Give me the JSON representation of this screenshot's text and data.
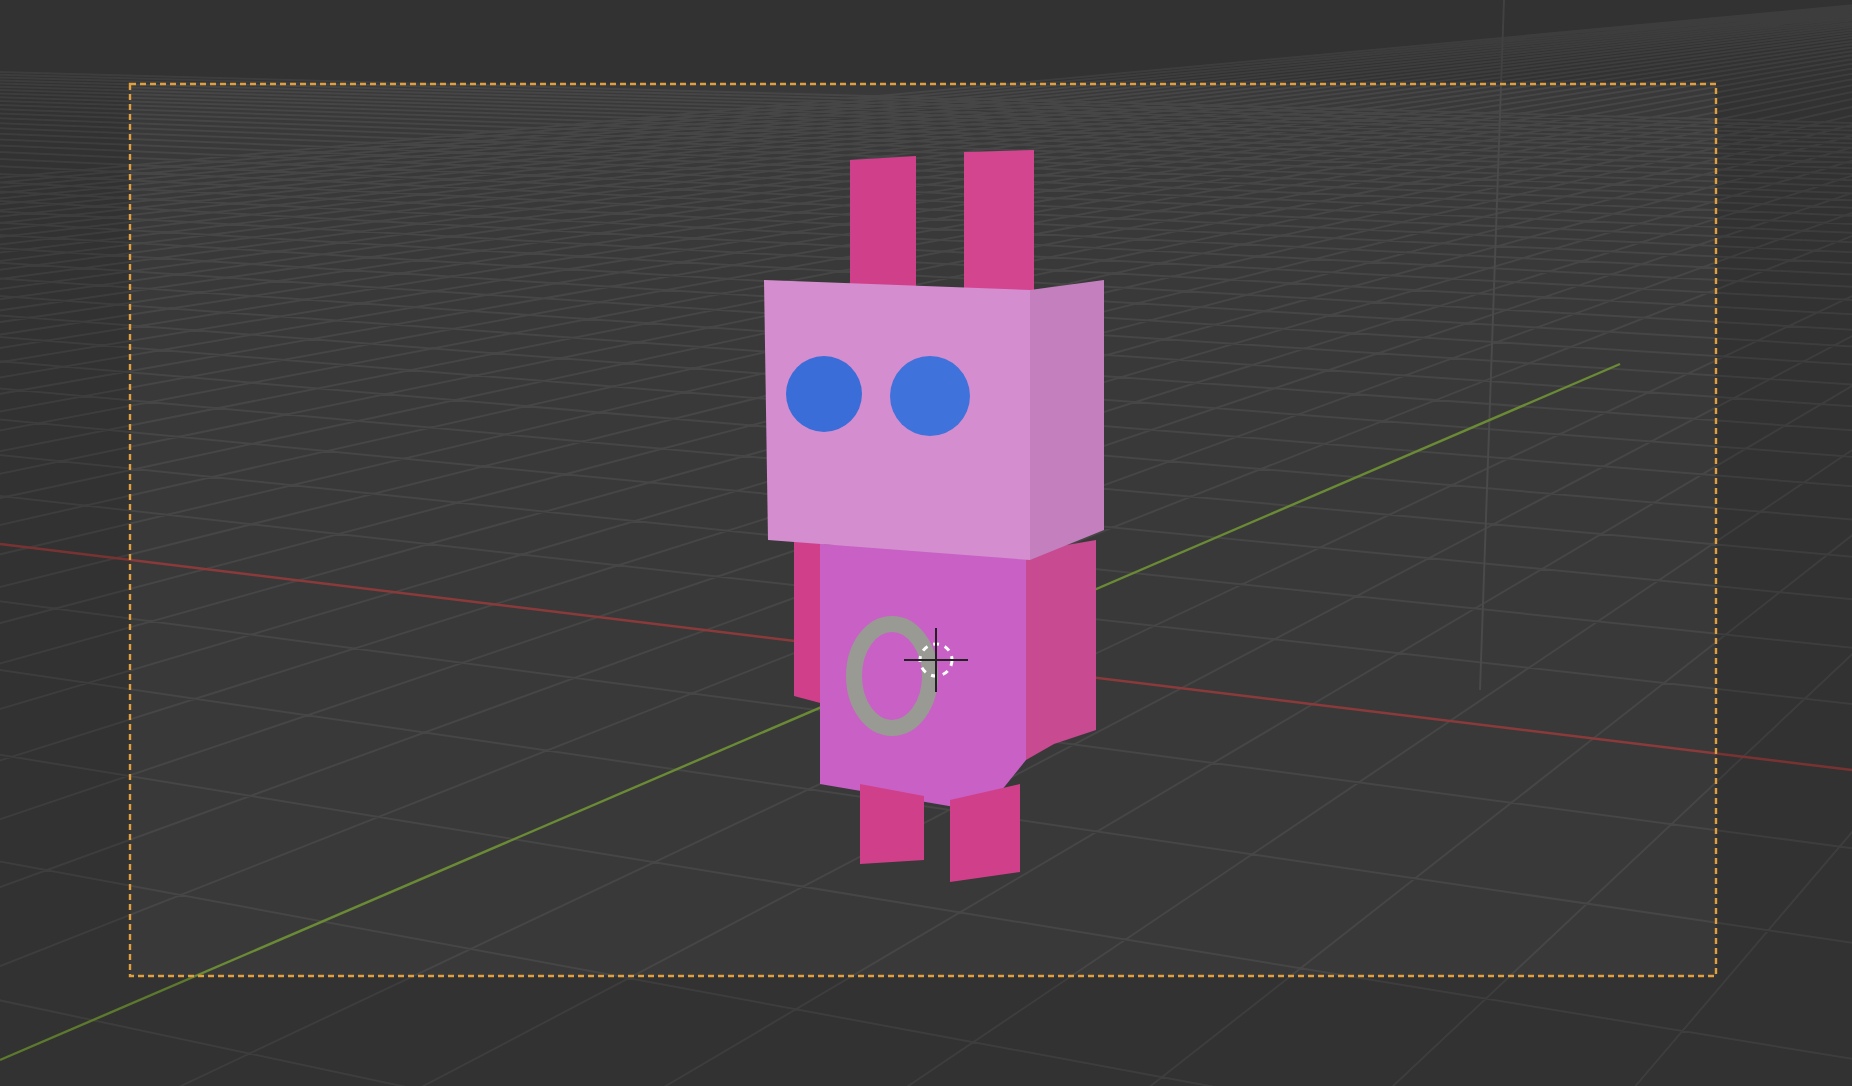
{
  "viewport": {
    "grid": true,
    "camera_frame": true,
    "cursor_3d": true
  }
}
